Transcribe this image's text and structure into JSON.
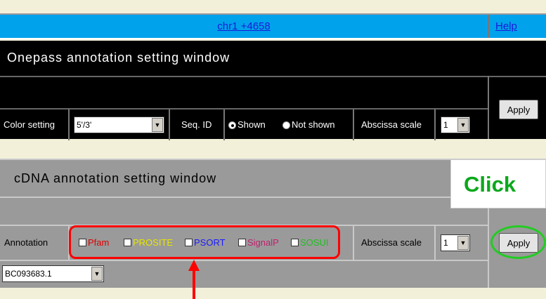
{
  "header": {
    "location_link": "chr1 +4658",
    "help_link": "Help"
  },
  "onepass": {
    "title": "Onepass annotation setting window",
    "apply_label": "Apply",
    "color_setting_label": "Color setting",
    "color_setting_value": "5'/3'",
    "seq_id_label": "Seq. ID",
    "radio_shown": "Shown",
    "radio_not_shown": "Not shown",
    "abscissa_label": "Abscissa scale",
    "abscissa_value": "1"
  },
  "cdna": {
    "title": "cDNA annotation setting window",
    "annotation_label": "Annotation",
    "checkboxes": [
      {
        "label": "Pfam",
        "color": "#e00000"
      },
      {
        "label": "PROSITE",
        "color": "#e6e600"
      },
      {
        "label": "PSORT",
        "color": "#1a1aff"
      },
      {
        "label": "SignalP",
        "color": "#c21f6f"
      },
      {
        "label": "SOSUI",
        "color": "#1fbf1f"
      }
    ],
    "abscissa_label": "Abscissa scale",
    "abscissa_value": "1",
    "apply_label": "Apply",
    "accession_value": "BC093683.1"
  },
  "annotations": {
    "click_text": "Click"
  }
}
